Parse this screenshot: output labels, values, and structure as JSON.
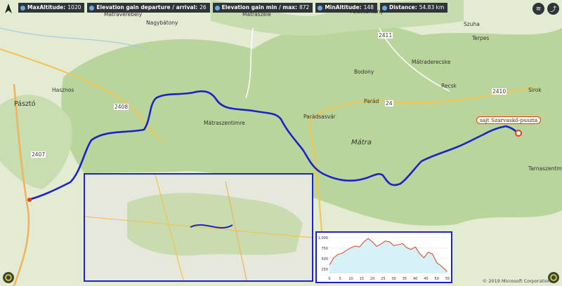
{
  "stats": [
    {
      "label": "MaxAltitude:",
      "value": "1020"
    },
    {
      "label": "Elevation gain departure / arrival:",
      "value": "26"
    },
    {
      "label": "Elevation gain min / max:",
      "value": "872"
    },
    {
      "label": "MinAltitude:",
      "value": "148"
    },
    {
      "label": "Distance:",
      "value": "54.83 km"
    }
  ],
  "map": {
    "towns": [
      "Mátraverebély",
      "Nagybátony",
      "Mátraszele",
      "Hasznos",
      "Pásztó",
      "Mátraszentimre",
      "Parádsasvár",
      "Mátra",
      "Parád",
      "Bodony",
      "Recsk",
      "Sirok",
      "Tarnaszentmária",
      "Mátraderecske",
      "Szuha",
      "Felsőtárkány",
      "Terpes"
    ],
    "roads": [
      "2408",
      "2407",
      "24",
      "2411",
      "2410"
    ],
    "poi_label": "sajt Szarvaskő-puszta"
  },
  "profile_chart": {
    "y_ticks": [
      "250",
      "500",
      "750",
      "1,000"
    ],
    "x_ticks": [
      "0",
      "5",
      "10",
      "15",
      "20",
      "25",
      "30",
      "35",
      "40",
      "45",
      "50",
      "55"
    ]
  },
  "chart_data": {
    "type": "line",
    "x": [
      0,
      2,
      4,
      6,
      8,
      10,
      12,
      14,
      16,
      18,
      20,
      22,
      24,
      26,
      28,
      30,
      32,
      34,
      36,
      38,
      40,
      42,
      44,
      46,
      48,
      50,
      52,
      54.83
    ],
    "series": [
      {
        "values": [
          350,
          520,
          600,
          630,
          700,
          760,
          800,
          780,
          900,
          980,
          900,
          790,
          850,
          920,
          900,
          810,
          830,
          860,
          760,
          720,
          780,
          620,
          520,
          650,
          610,
          400,
          330,
          190
        ]
      }
    ],
    "ylim": [
      148,
      1050
    ],
    "xlim": [
      0,
      55
    ]
  },
  "copyright": "© 2019 Microsoft Corporation",
  "colors": {
    "track": "#1a22c8",
    "profile_line": "#e2401a",
    "forest": "#b9d59b",
    "land": "#e4ebd3"
  }
}
